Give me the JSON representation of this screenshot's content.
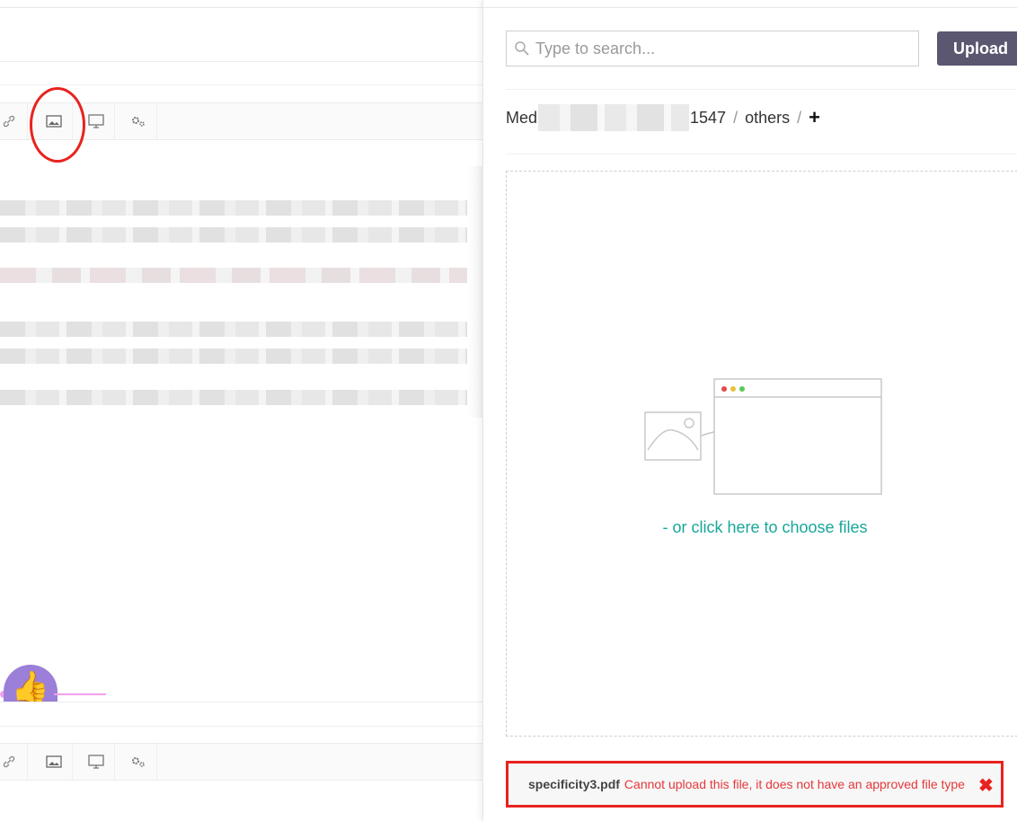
{
  "search": {
    "placeholder": "Type to search..."
  },
  "upload": {
    "label": "Upload"
  },
  "breadcrumb": {
    "first": "Med",
    "second": "1547",
    "separator": "/",
    "third": "others",
    "add": "+"
  },
  "dropzone": {
    "choose_text": "- or click here to choose files"
  },
  "error": {
    "filename": "specificity3.pdf",
    "message": "Cannot upload this file, it does not have an approved file type",
    "close_icon": "✖"
  },
  "editor": {
    "toolbar_icons": [
      "link-icon",
      "image-icon",
      "monitor-icon",
      "gears-icon"
    ],
    "avatar_emoji": "👍"
  },
  "colors": {
    "accent": "#18a79a",
    "upload_button": "#5b5770",
    "error": "#e5383b",
    "annotation": "#e8231f"
  }
}
